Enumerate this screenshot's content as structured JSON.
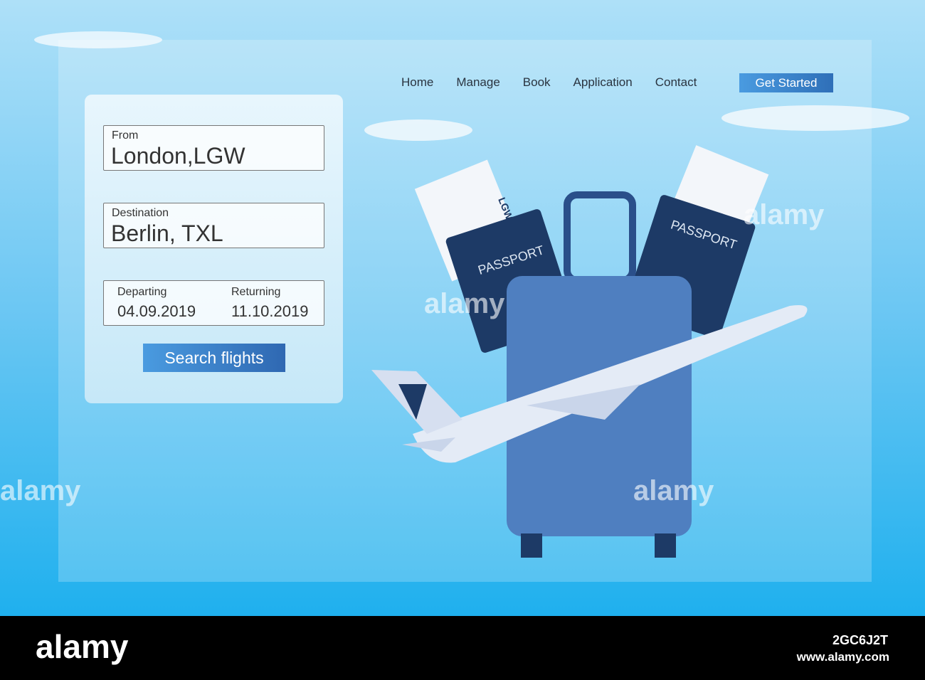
{
  "nav": {
    "items": [
      "Home",
      "Manage",
      "Book",
      "Application",
      "Contact"
    ],
    "cta": "Get Started"
  },
  "form": {
    "from": {
      "label": "From",
      "value": "London,LGW"
    },
    "destination": {
      "label": "Destination",
      "value": "Berlin, TXL"
    },
    "departing": {
      "label": "Departing",
      "value": "04.09.2019"
    },
    "returning": {
      "label": "Returning",
      "value": "11.10.2019"
    },
    "search_label": "Search flights"
  },
  "illustration": {
    "passport_text": "PASSPORT",
    "ticket_code": "LGW"
  },
  "watermark": {
    "logo": "alamy",
    "image_id": "2GC6J2T",
    "url": "www.alamy.com"
  },
  "colors": {
    "accent": "#3a82cc",
    "suitcase": "#4f7fc0",
    "passport": "#1d3a66"
  }
}
